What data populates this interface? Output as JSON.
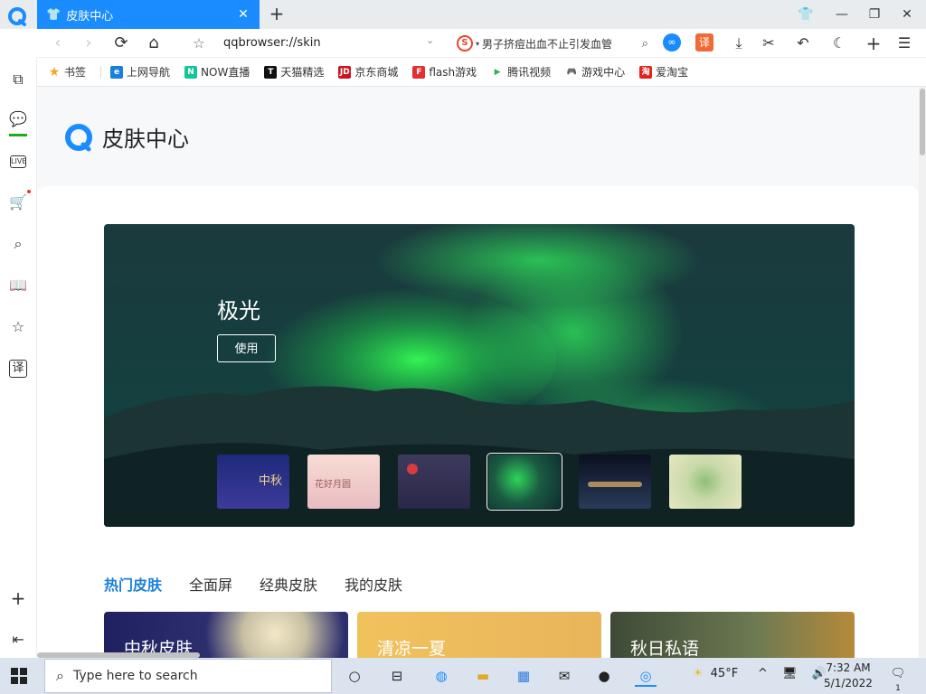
{
  "tab": {
    "title": "皮肤中心"
  },
  "address": {
    "url": "qqbrowser://skin",
    "search_value": "男子挤痘出血不止引发血管"
  },
  "bookmarks": [
    {
      "label": "书签",
      "color": "#f5a623",
      "icon": "star-icon"
    },
    {
      "label": "上网导航",
      "color": "#1a7fd9",
      "icon": "e"
    },
    {
      "label": "NOW直播",
      "color": "#14c49a",
      "icon": "N"
    },
    {
      "label": "天猫精选",
      "color": "#111111",
      "icon": "T"
    },
    {
      "label": "京东商城",
      "color": "#c9151e",
      "icon": "JD"
    },
    {
      "label": "flash游戏",
      "color": "#e03030",
      "icon": "F"
    },
    {
      "label": "腾讯视频",
      "color": "#32b24a",
      "icon": "play-icon"
    },
    {
      "label": "游戏中心",
      "color": "#ff8a00",
      "icon": "gamepad-icon"
    },
    {
      "label": "爱淘宝",
      "color": "#e2231a",
      "icon": "淘"
    }
  ],
  "page": {
    "title": "皮肤中心"
  },
  "hero": {
    "title": "极光",
    "use_label": "使用"
  },
  "thumbs": [
    {
      "caption": "中秋"
    },
    {
      "caption": "花好月圆"
    },
    {
      "caption": ""
    },
    {
      "caption": "",
      "selected": true
    },
    {
      "caption": ""
    },
    {
      "caption": ""
    }
  ],
  "categories": [
    "热门皮肤",
    "全面屏",
    "经典皮肤",
    "我的皮肤"
  ],
  "skins": [
    {
      "title": "中秋皮肤"
    },
    {
      "title": "清凉一夏"
    },
    {
      "title": "秋日私语"
    }
  ],
  "taskbar": {
    "search_placeholder": "Type here to search",
    "temperature": "45°F",
    "time": "7:32 AM",
    "date": "5/1/2022",
    "notifications": "1"
  },
  "colors": {
    "accent": "#1a8cff",
    "active_category": "#1a7fd9",
    "side_active": "#1aad19"
  }
}
